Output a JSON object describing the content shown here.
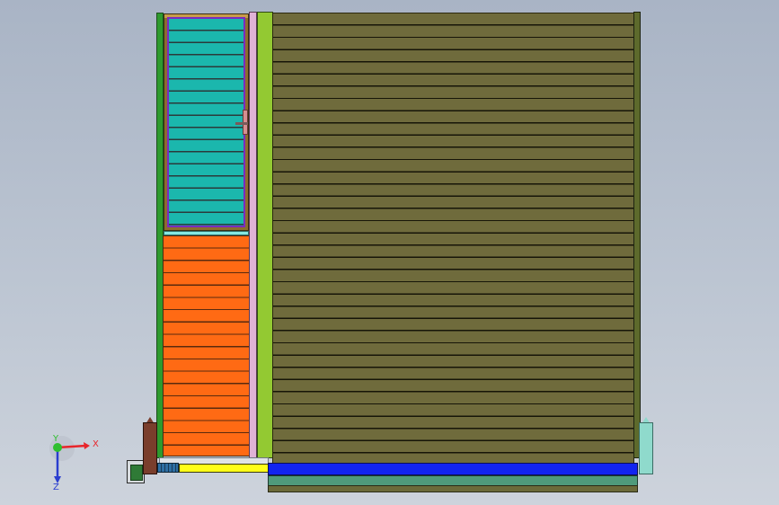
{
  "viewport": {
    "background_top": "#a9b4c5",
    "background_bottom": "#cdd3dc"
  },
  "triad": {
    "x_label": "X",
    "y_label": "Y",
    "z_label": "Z",
    "colors": {
      "x": "#e8252b",
      "y": "#2fbf2f",
      "z": "#2a3ecf"
    }
  },
  "colors": {
    "cyan_panel": "#1bb7ad",
    "orange_panel": "#ff6a14",
    "main_panel": "#6f6b3c",
    "green_rail": "#2e9a2e",
    "lime_separator": "#93c932",
    "pink_separator": "#e0b2d6",
    "blue_bar": "#1224f0",
    "teal_bar": "#4f9a7b",
    "yellow_bar": "#ffff1a"
  }
}
